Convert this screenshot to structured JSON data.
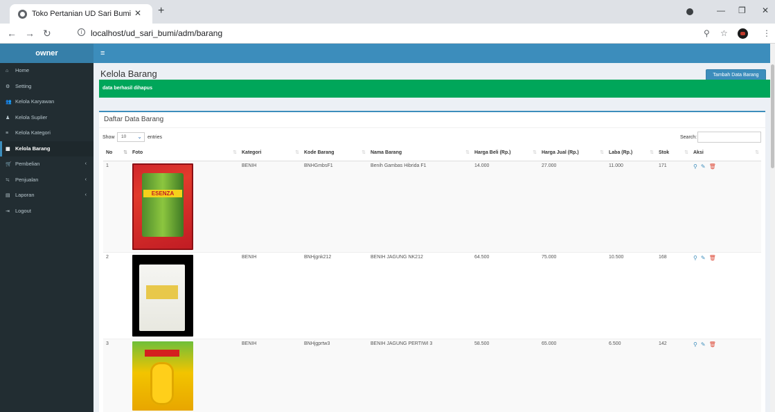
{
  "browser": {
    "tab_title": "Toko Pertanian UD Sari Bumi",
    "url": "localhost/ud_sari_bumi/adm/barang"
  },
  "app": {
    "brand": "owner"
  },
  "sidebar": {
    "items": [
      {
        "label": "Home",
        "icon": "home-icon",
        "glyph": "⌂"
      },
      {
        "label": "Setting",
        "icon": "gear-icon",
        "glyph": "⚙"
      },
      {
        "label": "Kelola Karyawan",
        "icon": "users-icon",
        "glyph": "👥"
      },
      {
        "label": "Kelola Suplier",
        "icon": "user-icon",
        "glyph": "♟"
      },
      {
        "label": "Kelola Kategori",
        "icon": "list-icon",
        "glyph": "≡"
      },
      {
        "label": "Kelola Barang",
        "icon": "table-icon",
        "glyph": "▦"
      },
      {
        "label": "Pembelian",
        "icon": "cart-icon",
        "glyph": "🛒"
      },
      {
        "label": "Penjualan",
        "icon": "cart-out-icon",
        "glyph": "≒"
      },
      {
        "label": "Laporan",
        "icon": "report-icon",
        "glyph": "▤"
      },
      {
        "label": "Logout",
        "icon": "logout-icon",
        "glyph": "⇥"
      }
    ]
  },
  "page": {
    "title": "Kelola Barang",
    "add_button": "Tambah Data Barang",
    "alert": "data berhasil dihapus"
  },
  "box": {
    "title": "Daftar Data Barang",
    "show": "Show",
    "entries_value": "10",
    "entries": "entries",
    "search_label": "Search:"
  },
  "table": {
    "headers": [
      "No",
      "Foto",
      "Kategori",
      "Kode Barang",
      "Nama Barang",
      "Harga Beli (Rp.)",
      "Harga Jual (Rp.)",
      "Laba (Rp.)",
      "Stok",
      "Aksi"
    ],
    "rows": [
      {
        "no": "1",
        "kategori": "BENIH",
        "kode": "BNHGmbsF1",
        "nama": "Benih Gambas Hibrida F1",
        "beli": "14.000",
        "jual": "27.000",
        "laba": "11.000",
        "stok": "171",
        "photo_text": "ESENZA"
      },
      {
        "no": "2",
        "kategori": "BENIH",
        "kode": "BNHjgnk212",
        "nama": "BENIH JAGUNG NK212",
        "beli": "64.500",
        "jual": "75.000",
        "laba": "10.500",
        "stok": "168"
      },
      {
        "no": "3",
        "kategori": "BENIH",
        "kode": "BNHjgprtw3",
        "nama": "BENIH JAGUNG PERTIWI 3",
        "beli": "58.500",
        "jual": "65.000",
        "laba": "6.500",
        "stok": "142"
      }
    ]
  },
  "colors": {
    "primary": "#3c8dbc",
    "success": "#00a65a",
    "sidebar": "#222d32",
    "danger": "#dd4b39"
  }
}
